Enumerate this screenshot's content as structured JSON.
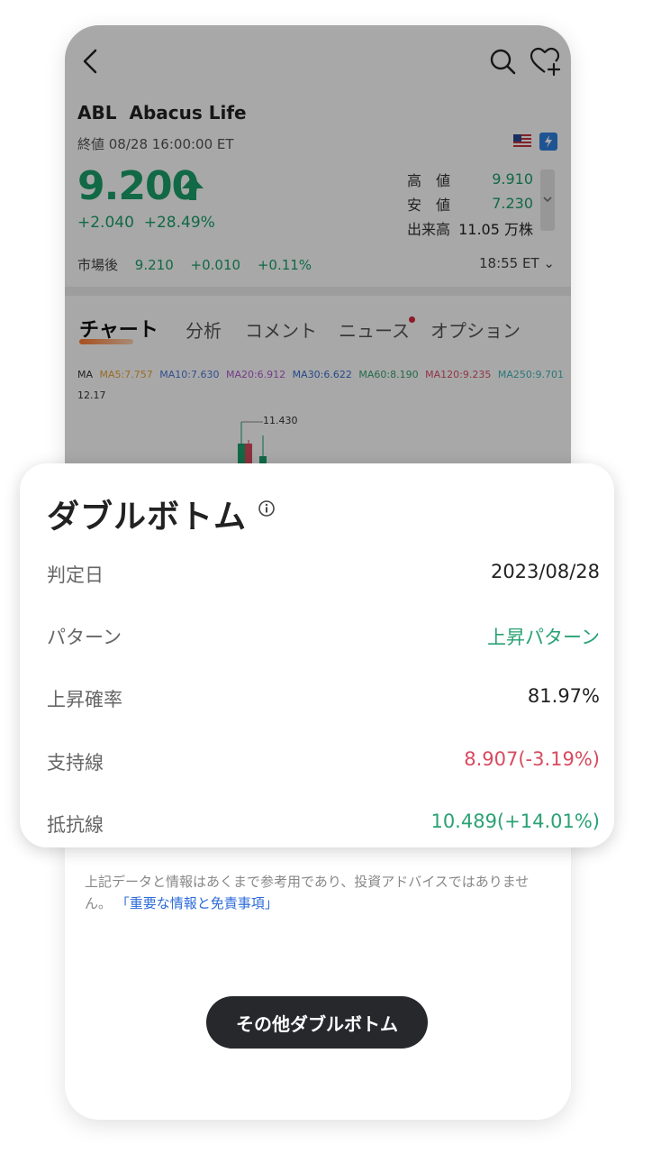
{
  "stock": {
    "symbol": "ABL",
    "name": "Abacus Life",
    "close_time": "終値 08/28 16:00:00 ET",
    "price": "9.200",
    "change": "+2.040",
    "change_pct": "+28.49%",
    "stats": [
      {
        "label": "高　値",
        "value": "9.910"
      },
      {
        "label": "安　値",
        "value": "7.230"
      },
      {
        "label": "出来高",
        "value": "11.05 万株"
      }
    ],
    "after_hours": {
      "label": "市場後",
      "price": "9.210",
      "change": "+0.010",
      "change_pct": "+0.11%",
      "time": "18:55 ET"
    }
  },
  "tabs": [
    "チャート",
    "分析",
    "コメント",
    "ニュース",
    "オプション"
  ],
  "chart": {
    "ma_items": [
      {
        "text": "MA",
        "color": "#333333"
      },
      {
        "text": "MA5:7.757",
        "color": "#e8a33b"
      },
      {
        "text": "MA10:7.630",
        "color": "#4c79d9"
      },
      {
        "text": "MA20:6.912",
        "color": "#b05bd1"
      },
      {
        "text": "MA30:6.622",
        "color": "#3b6fd1"
      },
      {
        "text": "MA60:8.190",
        "color": "#3aa372"
      },
      {
        "text": "MA120:9.235",
        "color": "#d9506b"
      },
      {
        "text": "MA250:9.701",
        "color": "#43b5b8"
      }
    ],
    "high_axis": "12.17",
    "peak_label": "11.430"
  },
  "card": {
    "title": "ダブルボトム",
    "rows": [
      {
        "label": "判定日",
        "value": "2023/08/28",
        "tone": "neutral"
      },
      {
        "label": "パターン",
        "value": "上昇パターン",
        "tone": "green"
      },
      {
        "label": "上昇確率",
        "value": "81.97%",
        "tone": "neutral"
      },
      {
        "label": "支持線",
        "value": "8.907(-3.19%)",
        "tone": "red"
      },
      {
        "label": "抵抗線",
        "value": "10.489(+14.01%)",
        "tone": "green"
      }
    ]
  },
  "disclaimer": {
    "text": "上記データと情報はあくまで参考用であり、投資アドバイスではありません。",
    "link": "「重要な情報と免責事項」"
  },
  "more_button": "その他ダブルボトム",
  "colors": {
    "up": "#1aa06b",
    "down": "#d84a5f",
    "button_bg": "#26282c"
  }
}
